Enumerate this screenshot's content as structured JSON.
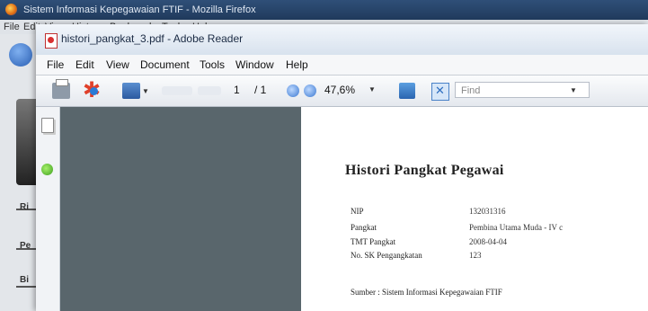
{
  "firefox": {
    "title": "Sistem Informasi Kepegawaian FTIF - Mozilla Firefox",
    "menu": [
      "File",
      "Edit",
      "View",
      "History",
      "Bookmarks",
      "Tools",
      "Help"
    ],
    "side_labels": [
      "Ri",
      "Pe",
      "Bi"
    ]
  },
  "reader": {
    "title": "histori_pangkat_3.pdf - Adobe Reader",
    "menu": [
      "File",
      "Edit",
      "View",
      "Document",
      "Tools",
      "Window",
      "Help"
    ],
    "toolbar": {
      "page_current": "1",
      "page_total": "/ 1",
      "zoom": "47,6%",
      "find_placeholder": "Find"
    }
  },
  "document": {
    "title": "Histori Pangkat Pegawai",
    "fields": [
      {
        "label": "NIP",
        "value": "132031316"
      },
      {
        "label": "Pangkat",
        "value": "Pembina Utama Muda - IV c"
      },
      {
        "label": "TMT Pangkat",
        "value": "2008-04-04"
      },
      {
        "label": "No. SK Pengangkatan",
        "value": "123"
      }
    ],
    "source": "Sumber : Sistem Informasi Kepegawaian FTIF"
  }
}
